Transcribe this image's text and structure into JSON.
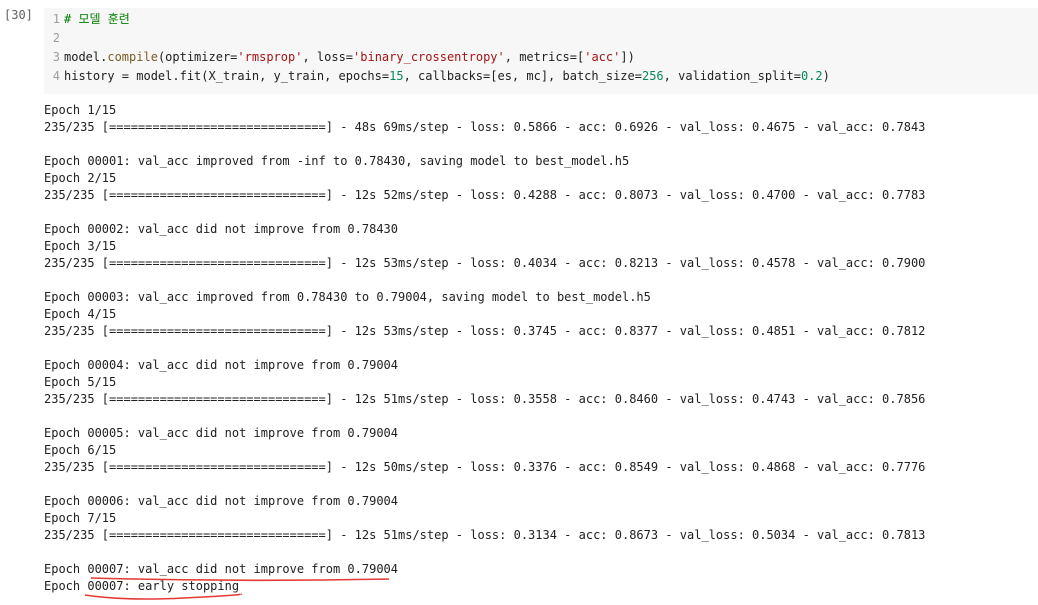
{
  "prompt": "[30]",
  "code": {
    "line1": {
      "num": "1",
      "text": "# 모델 훈련"
    },
    "line2": {
      "num": "2",
      "text": ""
    },
    "line3": {
      "num": "3",
      "p1": "model.",
      "fn": "compile",
      "p2": "(optimizer=",
      "s1": "'rmsprop'",
      "p3": ", loss=",
      "s2": "'binary_crossentropy'",
      "p4": ", metrics=[",
      "s3": "'acc'",
      "p5": "])"
    },
    "line4": {
      "num": "4",
      "p1": "history = model.fit(X_train, y_train, epochs=",
      "n1": "15",
      "p2": ", callbacks=[es, mc], batch_size=",
      "n2": "256",
      "p3": ", validation_split=",
      "n3": "0.2",
      "p4": ")"
    }
  },
  "output": [
    "Epoch 1/15",
    "235/235 [==============================] - 48s 69ms/step - loss: 0.5866 - acc: 0.6926 - val_loss: 0.4675 - val_acc: 0.7843",
    "",
    "Epoch 00001: val_acc improved from -inf to 0.78430, saving model to best_model.h5",
    "Epoch 2/15",
    "235/235 [==============================] - 12s 52ms/step - loss: 0.4288 - acc: 0.8073 - val_loss: 0.4700 - val_acc: 0.7783",
    "",
    "Epoch 00002: val_acc did not improve from 0.78430",
    "Epoch 3/15",
    "235/235 [==============================] - 12s 53ms/step - loss: 0.4034 - acc: 0.8213 - val_loss: 0.4578 - val_acc: 0.7900",
    "",
    "Epoch 00003: val_acc improved from 0.78430 to 0.79004, saving model to best_model.h5",
    "Epoch 4/15",
    "235/235 [==============================] - 12s 53ms/step - loss: 0.3745 - acc: 0.8377 - val_loss: 0.4851 - val_acc: 0.7812",
    "",
    "Epoch 00004: val_acc did not improve from 0.79004",
    "Epoch 5/15",
    "235/235 [==============================] - 12s 51ms/step - loss: 0.3558 - acc: 0.8460 - val_loss: 0.4743 - val_acc: 0.7856",
    "",
    "Epoch 00005: val_acc did not improve from 0.79004",
    "Epoch 6/15",
    "235/235 [==============================] - 12s 50ms/step - loss: 0.3376 - acc: 0.8549 - val_loss: 0.4868 - val_acc: 0.7776",
    "",
    "Epoch 00006: val_acc did not improve from 0.79004",
    "Epoch 7/15",
    "235/235 [==============================] - 12s 51ms/step - loss: 0.3134 - acc: 0.8673 - val_loss: 0.5034 - val_acc: 0.7813",
    "",
    "Epoch 00007: val_acc did not improve from 0.79004",
    "Epoch 00007: early stopping"
  ],
  "colors": {
    "annotation": "#e53935",
    "editor_bg": "#f7f7f7"
  }
}
